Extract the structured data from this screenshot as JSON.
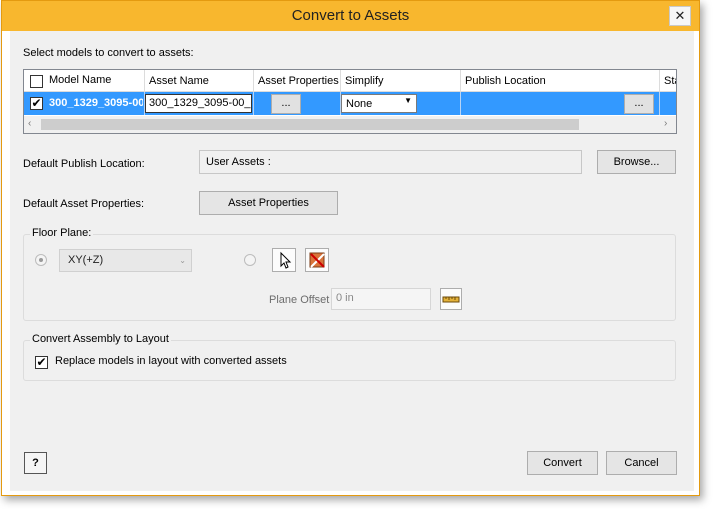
{
  "window": {
    "title": "Convert to Assets",
    "close_glyph": "✕"
  },
  "prompt": "Select models to convert to assets:",
  "grid": {
    "columns": [
      "Model Name",
      "Asset Name",
      "Asset Properties",
      "Simplify",
      "Publish Location",
      "Sta"
    ],
    "row": {
      "model_name": "300_1329_3095-00",
      "asset_name": "300_1329_3095-00_c",
      "asset_properties_btn": "...",
      "simplify": "None",
      "publish_location_btn": "...",
      "checked": true
    }
  },
  "publish": {
    "label": "Default Publish Location:",
    "value": "User Assets :",
    "browse": "Browse..."
  },
  "asset_props": {
    "label": "Default Asset Properties:",
    "button": "Asset Properties"
  },
  "floor_plane": {
    "title": "Floor Plane:",
    "plane_option": "XY(+Z)",
    "offset_label": "Plane Offset",
    "offset_value": "0 in"
  },
  "convert_layout": {
    "title": "Convert Assembly to Layout",
    "replace_label": "Replace models in layout with converted assets",
    "replace_checked": true
  },
  "footer": {
    "help_icon": "?",
    "convert": "Convert",
    "cancel": "Cancel"
  },
  "colors": {
    "title_bar": "#f8b72e",
    "selection": "#3399ff",
    "dialog_bg": "#f0f0f0"
  }
}
